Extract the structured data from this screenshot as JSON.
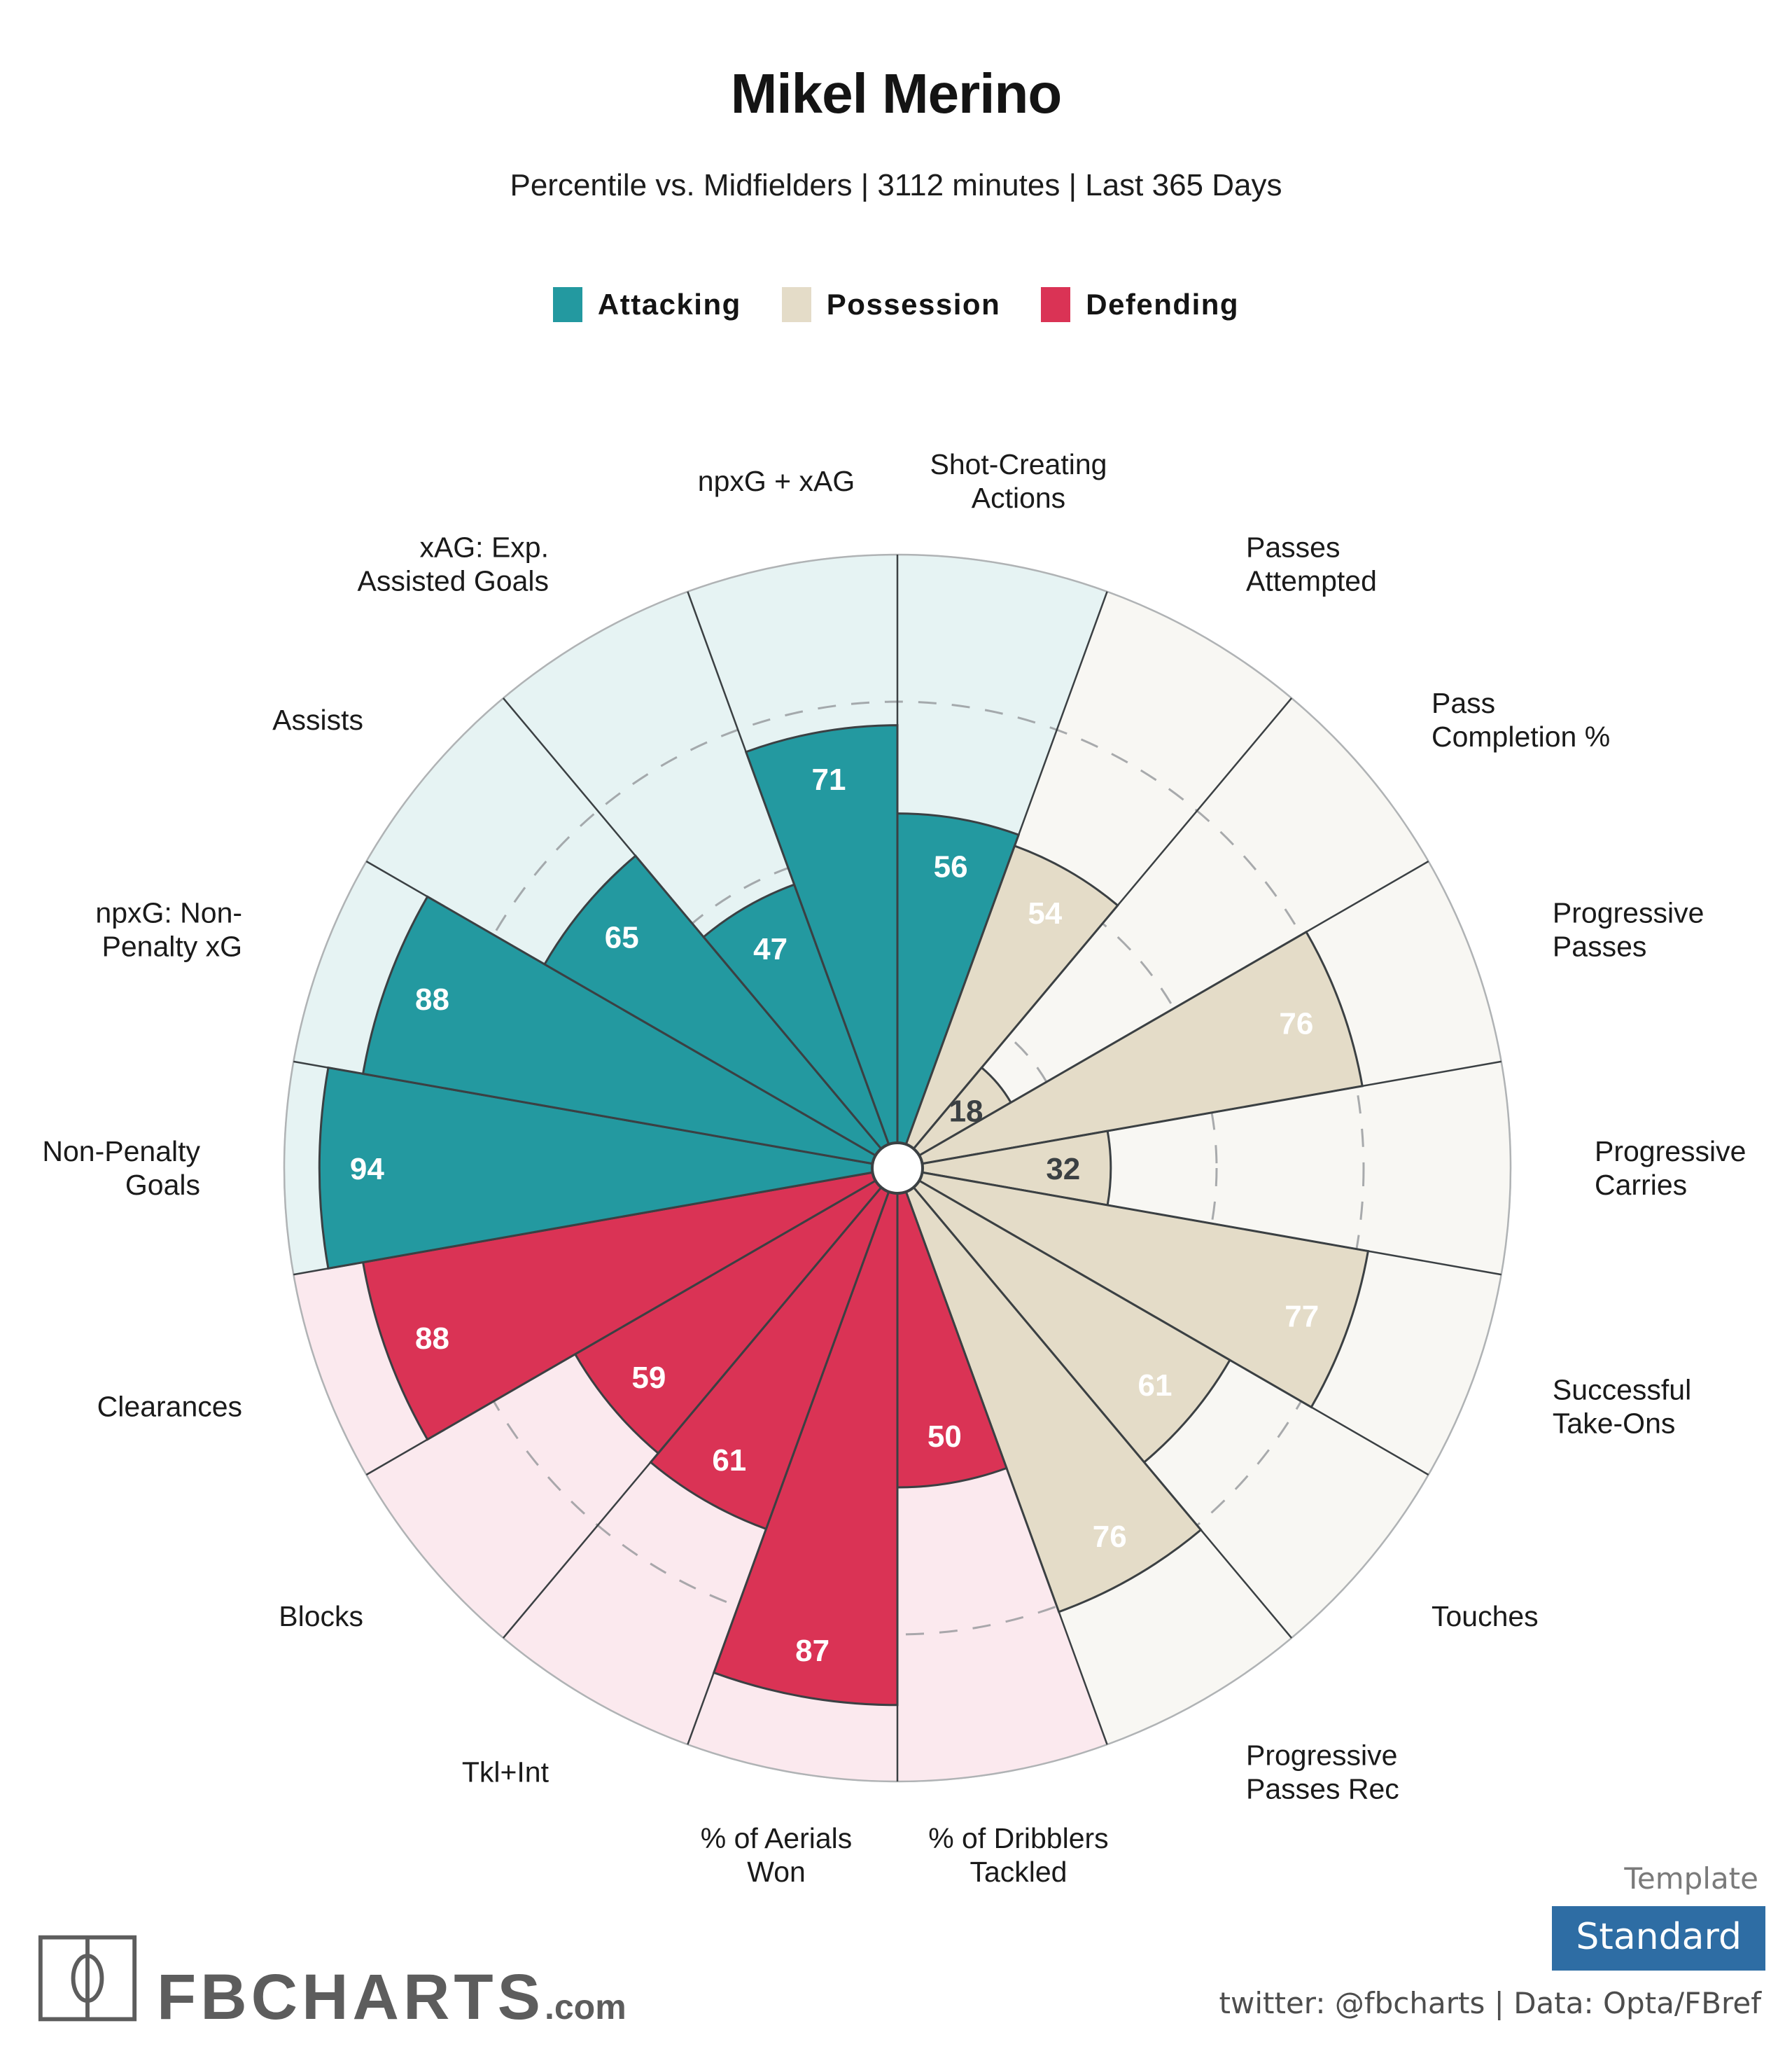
{
  "header": {
    "player_name": "Mikel Merino",
    "subtitle": "Percentile vs. Midfielders | 3112 minutes | Last 365 Days"
  },
  "legend": [
    {
      "label": "Attacking",
      "color": "#2399a0"
    },
    {
      "label": "Possession",
      "color": "#e4dcc8"
    },
    {
      "label": "Defending",
      "color": "#da3355"
    }
  ],
  "colors": {
    "attacking": "#2399a0",
    "attacking_bg": "#e6f3f3",
    "possession": "#e4dcc8",
    "possession_bg": "#f8f7f3",
    "defending": "#da3355",
    "defending_bg": "#fbe9ee",
    "spoke": "#3b4043",
    "grid_dash": "#8d9094",
    "hub": "#ffffff",
    "template_badge": "#2e6da4",
    "logo": "#5d5d5d"
  },
  "footer": {
    "template_label": "Template",
    "template_value": "Standard",
    "credit": "twitter: @fbcharts | Data: Opta/FBref",
    "logo_text": "FBCHARTS",
    "logo_suffix": ".com"
  },
  "chart_data": {
    "type": "pie",
    "title": "Mikel Merino",
    "subtitle": "Percentile vs. Midfielders | 3112 minutes | Last 365 Days",
    "ylim": [
      0,
      100
    ],
    "grid": true,
    "gridlines": [
      25,
      50,
      75
    ],
    "legend_position": "top",
    "start_angle_deg": -90,
    "sector_span_deg": 20,
    "n_sectors": 18,
    "groups": [
      "Attacking",
      "Possession",
      "Defending"
    ],
    "categories": [
      "Shot-Creating Actions",
      "Passes Attempted",
      "Pass Completion %",
      "Progressive Passes",
      "Progressive Carries",
      "Successful Take-Ons",
      "Touches",
      "Progressive Passes Rec",
      "% of Dribblers Tackled",
      "% of Aerials Won",
      "Tkl+Int",
      "Blocks",
      "Clearances",
      "Non-Penalty Goals",
      "npxG: Non-Penalty xG",
      "Assists",
      "xAG: Exp. Assisted Goals",
      "npxG + xAG"
    ],
    "values": [
      56,
      54,
      18,
      76,
      32,
      77,
      61,
      76,
      50,
      87,
      61,
      59,
      88,
      94,
      88,
      65,
      47,
      71
    ],
    "sector_groups": [
      "Attacking",
      "Possession",
      "Possession",
      "Possession",
      "Possession",
      "Possession",
      "Possession",
      "Possession",
      "Defending",
      "Defending",
      "Defending",
      "Defending",
      "Defending",
      "Attacking",
      "Attacking",
      "Attacking",
      "Attacking",
      "Attacking"
    ],
    "sectors": [
      {
        "label": "Shot-Creating Actions",
        "label_lines": [
          "Shot-Creating",
          "Actions"
        ],
        "value": 56,
        "group": "Attacking"
      },
      {
        "label": "Passes Attempted",
        "label_lines": [
          "Passes",
          "Attempted"
        ],
        "value": 54,
        "group": "Possession"
      },
      {
        "label": "Pass Completion %",
        "label_lines": [
          "Pass",
          "Completion %"
        ],
        "value": 18,
        "group": "Possession"
      },
      {
        "label": "Progressive Passes",
        "label_lines": [
          "Progressive",
          "Passes"
        ],
        "value": 76,
        "group": "Possession"
      },
      {
        "label": "Progressive Carries",
        "label_lines": [
          "Progressive",
          "Carries"
        ],
        "value": 32,
        "group": "Possession"
      },
      {
        "label": "Successful Take-Ons",
        "label_lines": [
          "Successful",
          "Take-Ons"
        ],
        "value": 77,
        "group": "Possession"
      },
      {
        "label": "Touches",
        "label_lines": [
          "Touches"
        ],
        "value": 61,
        "group": "Possession"
      },
      {
        "label": "Progressive Passes Rec",
        "label_lines": [
          "Progressive",
          "Passes Rec"
        ],
        "value": 76,
        "group": "Possession"
      },
      {
        "label": "% of Dribblers Tackled",
        "label_lines": [
          "% of Dribblers",
          "Tackled"
        ],
        "value": 50,
        "group": "Defending"
      },
      {
        "label": "% of Aerials Won",
        "label_lines": [
          "% of Aerials",
          "Won"
        ],
        "value": 87,
        "group": "Defending"
      },
      {
        "label": "Tkl+Int",
        "label_lines": [
          "Tkl+Int"
        ],
        "value": 61,
        "group": "Defending"
      },
      {
        "label": "Blocks",
        "label_lines": [
          "Blocks"
        ],
        "value": 59,
        "group": "Defending"
      },
      {
        "label": "Clearances",
        "label_lines": [
          "Clearances"
        ],
        "value": 88,
        "group": "Defending"
      },
      {
        "label": "Non-Penalty Goals",
        "label_lines": [
          "Non-Penalty",
          "Goals"
        ],
        "value": 94,
        "group": "Attacking"
      },
      {
        "label": "npxG: Non-Penalty xG",
        "label_lines": [
          "npxG: Non-",
          "Penalty xG"
        ],
        "value": 88,
        "group": "Attacking"
      },
      {
        "label": "Assists",
        "label_lines": [
          "Assists"
        ],
        "value": 65,
        "group": "Attacking"
      },
      {
        "label": "xAG: Exp. Assisted Goals",
        "label_lines": [
          "xAG: Exp.",
          "Assisted Goals"
        ],
        "value": 47,
        "group": "Attacking"
      },
      {
        "label": "npxG + xAG",
        "label_lines": [
          "npxG + xAG"
        ],
        "value": 71,
        "group": "Attacking"
      }
    ]
  }
}
